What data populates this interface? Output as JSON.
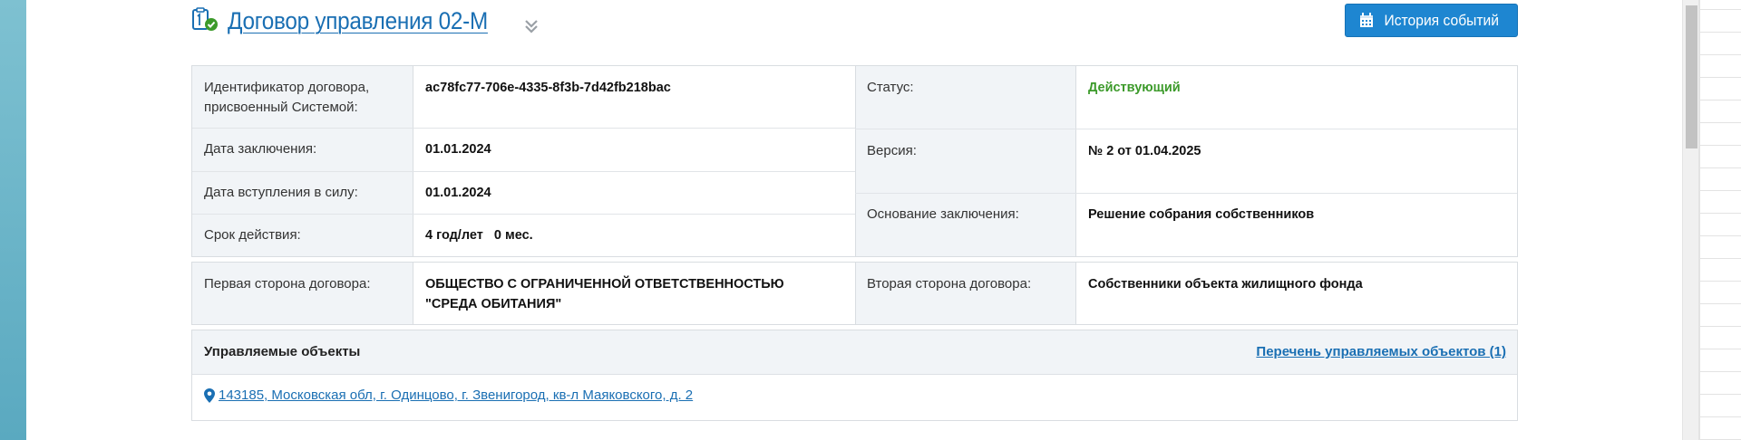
{
  "header": {
    "title": "Договор управления 02-М",
    "history_button_label": "История событий",
    "icons": {
      "doc": "document-check-icon",
      "chevron": "double-chevron-down-icon",
      "calendar": "calendar-icon"
    }
  },
  "details": {
    "id_label": "Идентификатор договора, присвоенный Системой:",
    "id_value": "ac78fc77-706e-4335-8f3b-7d42fb218bac",
    "status_label": "Статус:",
    "status_value": "Действующий",
    "conclusion_date_label": "Дата заключения:",
    "conclusion_date_value": "01.01.2024",
    "version_label": "Версия:",
    "version_value": "№ 2 от 01.04.2025",
    "effective_date_label": "Дата вступления в силу:",
    "effective_date_value": "01.01.2024",
    "basis_label": "Основание заключения:",
    "basis_value": "Решение собрания собственников",
    "term_label": "Срок действия:",
    "term_value": "4 год/лет   0 мес."
  },
  "parties": {
    "first_label": "Первая сторона договора:",
    "first_value": "ОБЩЕСТВО С ОГРАНИЧЕННОЙ ОТВЕТСТВЕННОСТЬЮ \"СРЕДА ОБИТАНИЯ\"",
    "second_label": "Вторая сторона договора:",
    "second_value": "Собственники объекта жилищного фонда"
  },
  "objects": {
    "title": "Управляемые объекты",
    "list_link": "Перечень управляемых объектов (1)",
    "address": " 143185, Московская обл, г. Одинцово, г. Звенигород, кв-л Маяковского, д. 2"
  },
  "colors": {
    "accent": "#1a6fb3",
    "button": "#1e86d1",
    "status_active": "#3c9a2a",
    "label_bg": "#f1f4f7"
  }
}
